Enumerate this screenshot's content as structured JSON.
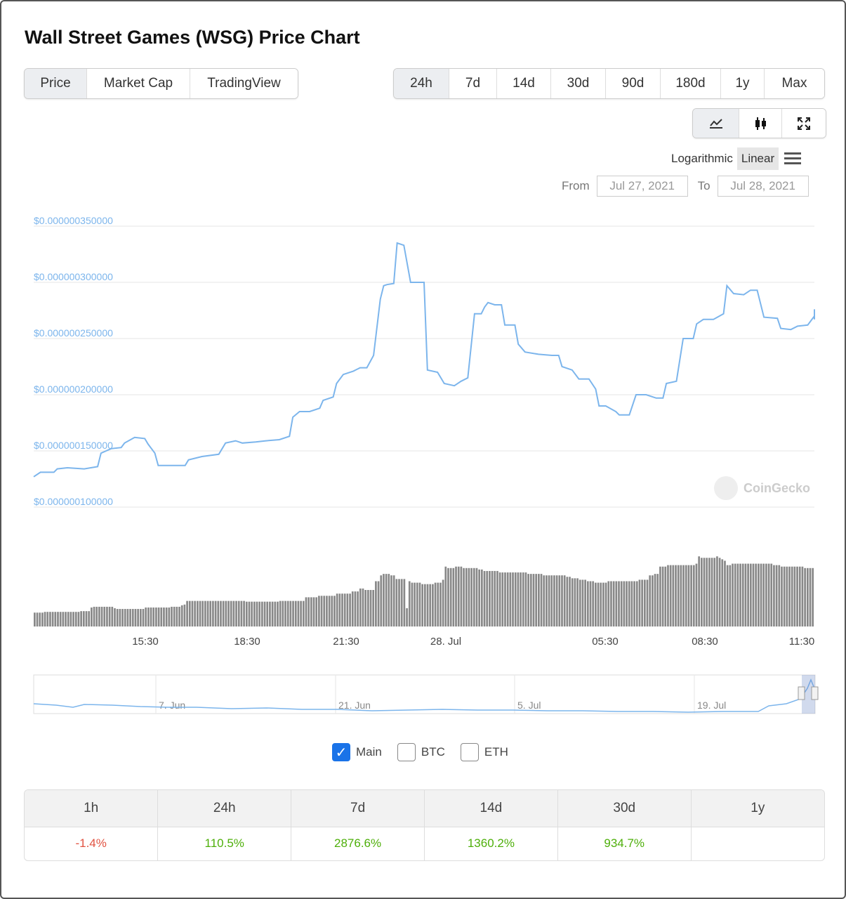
{
  "title": "Wall Street Games (WSG) Price Chart",
  "tabs": [
    "Price",
    "Market Cap",
    "TradingView"
  ],
  "ranges": [
    "24h",
    "7d",
    "14d",
    "30d",
    "90d",
    "180d",
    "1y",
    "Max"
  ],
  "chart_type_icons": [
    "line-chart-icon",
    "candlestick-icon",
    "fullscreen-icon"
  ],
  "scale": {
    "log": "Logarithmic",
    "linear": "Linear"
  },
  "date_range": {
    "from_label": "From",
    "from": "Jul 27, 2021",
    "to_label": "To",
    "to": "Jul 28, 2021"
  },
  "watermark": "CoinGecko",
  "colors": {
    "line": "#7cb5ec",
    "volume": "#888888",
    "positive": "#4eaf0a",
    "negative": "#e15241",
    "checkbox": "#1a73e8"
  },
  "series_toggles": [
    {
      "label": "Main",
      "checked": true
    },
    {
      "label": "BTC",
      "checked": false
    },
    {
      "label": "ETH",
      "checked": false
    }
  ],
  "stats": {
    "headers": [
      "1h",
      "24h",
      "7d",
      "14d",
      "30d",
      "1y"
    ],
    "values": [
      "-1.4%",
      "110.5%",
      "2876.6%",
      "1360.2%",
      "934.7%",
      ""
    ]
  },
  "chart_data": {
    "type": "line",
    "ylim": [
      1e-07,
      3.5e-07
    ],
    "y_tick_labels": [
      "$0.000000350000",
      "$0.000000300000",
      "$0.000000250000",
      "$0.000000200000",
      "$0.000000150000",
      "$0.000000100000"
    ],
    "y_ticks": [
      3.5e-07,
      3e-07,
      2.5e-07,
      2e-07,
      1.5e-07,
      1e-07
    ],
    "x_tick_labels": [
      "15:30",
      "18:30",
      "21:30",
      "28. Jul",
      "05:30",
      "08:30",
      "11:30"
    ],
    "x_range_hours": [
      12.3,
      35.5
    ],
    "x_ticks_hours": [
      15.5,
      18.5,
      21.5,
      24.5,
      29.5,
      32.5,
      35.5
    ],
    "price": [
      [
        12.3,
        1.27e-07
      ],
      [
        12.5,
        1.31e-07
      ],
      [
        12.9,
        1.31e-07
      ],
      [
        13.0,
        1.34e-07
      ],
      [
        13.3,
        1.35e-07
      ],
      [
        13.8,
        1.34e-07
      ],
      [
        14.0,
        1.35e-07
      ],
      [
        14.2,
        1.36e-07
      ],
      [
        14.3,
        1.48e-07
      ],
      [
        14.6,
        1.52e-07
      ],
      [
        14.9,
        1.53e-07
      ],
      [
        15.0,
        1.57e-07
      ],
      [
        15.3,
        1.62e-07
      ],
      [
        15.6,
        1.61e-07
      ],
      [
        15.7,
        1.56e-07
      ],
      [
        15.9,
        1.48e-07
      ],
      [
        16.0,
        1.37e-07
      ],
      [
        16.5,
        1.37e-07
      ],
      [
        16.8,
        1.37e-07
      ],
      [
        16.9,
        1.42e-07
      ],
      [
        17.3,
        1.45e-07
      ],
      [
        17.8,
        1.47e-07
      ],
      [
        17.9,
        1.52e-07
      ],
      [
        18.0,
        1.57e-07
      ],
      [
        18.3,
        1.59e-07
      ],
      [
        18.5,
        1.57e-07
      ],
      [
        18.9,
        1.58e-07
      ],
      [
        19.2,
        1.59e-07
      ],
      [
        19.6,
        1.6e-07
      ],
      [
        19.9,
        1.63e-07
      ],
      [
        20.0,
        1.8e-07
      ],
      [
        20.2,
        1.85e-07
      ],
      [
        20.5,
        1.85e-07
      ],
      [
        20.8,
        1.88e-07
      ],
      [
        20.9,
        1.95e-07
      ],
      [
        21.2,
        1.98e-07
      ],
      [
        21.3,
        2.1e-07
      ],
      [
        21.5,
        2.18e-07
      ],
      [
        21.8,
        2.21e-07
      ],
      [
        22.0,
        2.24e-07
      ],
      [
        22.2,
        2.24e-07
      ],
      [
        22.4,
        2.35e-07
      ],
      [
        22.6,
        2.85e-07
      ],
      [
        22.7,
        2.97e-07
      ],
      [
        22.8,
        2.98e-07
      ],
      [
        23.0,
        2.99e-07
      ],
      [
        23.1,
        3.35e-07
      ],
      [
        23.3,
        3.33e-07
      ],
      [
        23.5,
        3e-07
      ],
      [
        23.7,
        3e-07
      ],
      [
        23.9,
        3e-07
      ],
      [
        24.0,
        2.22e-07
      ],
      [
        24.3,
        2.2e-07
      ],
      [
        24.5,
        2.1e-07
      ],
      [
        24.8,
        2.08e-07
      ],
      [
        25.0,
        2.12e-07
      ],
      [
        25.2,
        2.15e-07
      ],
      [
        25.4,
        2.72e-07
      ],
      [
        25.6,
        2.72e-07
      ],
      [
        25.7,
        2.78e-07
      ],
      [
        25.8,
        2.82e-07
      ],
      [
        26.0,
        2.8e-07
      ],
      [
        26.2,
        2.8e-07
      ],
      [
        26.3,
        2.62e-07
      ],
      [
        26.6,
        2.62e-07
      ],
      [
        26.7,
        2.45e-07
      ],
      [
        26.9,
        2.38e-07
      ],
      [
        27.3,
        2.36e-07
      ],
      [
        27.7,
        2.35e-07
      ],
      [
        27.9,
        2.35e-07
      ],
      [
        28.0,
        2.25e-07
      ],
      [
        28.3,
        2.22e-07
      ],
      [
        28.5,
        2.14e-07
      ],
      [
        28.8,
        2.14e-07
      ],
      [
        29.0,
        2.05e-07
      ],
      [
        29.1,
        1.9e-07
      ],
      [
        29.3,
        1.9e-07
      ],
      [
        29.6,
        1.85e-07
      ],
      [
        29.7,
        1.82e-07
      ],
      [
        30.0,
        1.82e-07
      ],
      [
        30.2,
        2e-07
      ],
      [
        30.5,
        2e-07
      ],
      [
        30.8,
        1.97e-07
      ],
      [
        31.0,
        1.97e-07
      ],
      [
        31.1,
        2.1e-07
      ],
      [
        31.4,
        2.12e-07
      ],
      [
        31.6,
        2.5e-07
      ],
      [
        31.9,
        2.5e-07
      ],
      [
        32.0,
        2.63e-07
      ],
      [
        32.2,
        2.67e-07
      ],
      [
        32.5,
        2.67e-07
      ],
      [
        32.8,
        2.72e-07
      ],
      [
        32.9,
        2.97e-07
      ],
      [
        33.1,
        2.9e-07
      ],
      [
        33.4,
        2.89e-07
      ],
      [
        33.6,
        2.93e-07
      ],
      [
        33.8,
        2.93e-07
      ],
      [
        34.0,
        2.69e-07
      ],
      [
        34.4,
        2.68e-07
      ],
      [
        34.5,
        2.59e-07
      ],
      [
        34.8,
        2.58e-07
      ],
      [
        35.0,
        2.61e-07
      ],
      [
        35.3,
        2.62e-07
      ],
      [
        35.5,
        2.7e-07
      ],
      [
        35.8,
        2.75e-07
      ],
      [
        36.0,
        2.76e-07
      ],
      [
        36.1,
        2.73e-07
      ],
      [
        36.3,
        2.68e-07
      ],
      [
        36.5,
        2.67e-07
      ]
    ],
    "volume_relative": [
      0.19,
      0.19,
      0.19,
      0.19,
      0.2,
      0.2,
      0.2,
      0.2,
      0.2,
      0.2,
      0.2,
      0.2,
      0.2,
      0.2,
      0.2,
      0.2,
      0.2,
      0.2,
      0.21,
      0.21,
      0.21,
      0.21,
      0.26,
      0.27,
      0.27,
      0.27,
      0.27,
      0.27,
      0.27,
      0.27,
      0.27,
      0.25,
      0.24,
      0.24,
      0.24,
      0.24,
      0.24,
      0.24,
      0.24,
      0.24,
      0.24,
      0.24,
      0.24,
      0.26,
      0.26,
      0.26,
      0.26,
      0.26,
      0.26,
      0.26,
      0.26,
      0.26,
      0.26,
      0.27,
      0.27,
      0.27,
      0.27,
      0.29,
      0.3,
      0.35,
      0.35,
      0.35,
      0.35,
      0.35,
      0.35,
      0.35,
      0.35,
      0.35,
      0.35,
      0.35,
      0.35,
      0.35,
      0.35,
      0.35,
      0.35,
      0.35,
      0.35,
      0.35,
      0.35,
      0.35,
      0.35,
      0.35,
      0.34,
      0.34,
      0.34,
      0.34,
      0.34,
      0.34,
      0.34,
      0.34,
      0.34,
      0.34,
      0.34,
      0.34,
      0.34,
      0.35,
      0.35,
      0.35,
      0.35,
      0.35,
      0.35,
      0.35,
      0.35,
      0.35,
      0.35,
      0.4,
      0.4,
      0.4,
      0.4,
      0.4,
      0.42,
      0.42,
      0.42,
      0.42,
      0.42,
      0.42,
      0.42,
      0.45,
      0.45,
      0.45,
      0.45,
      0.45,
      0.45,
      0.48,
      0.48,
      0.48,
      0.52,
      0.52,
      0.5,
      0.5,
      0.5,
      0.5,
      0.62,
      0.62,
      0.7,
      0.72,
      0.72,
      0.72,
      0.7,
      0.7,
      0.65,
      0.65,
      0.65,
      0.65,
      0.25,
      0.62,
      0.6,
      0.6,
      0.6,
      0.6,
      0.58,
      0.58,
      0.58,
      0.58,
      0.58,
      0.6,
      0.6,
      0.6,
      0.64,
      0.82,
      0.8,
      0.8,
      0.8,
      0.82,
      0.82,
      0.82,
      0.8,
      0.8,
      0.8,
      0.8,
      0.8,
      0.8,
      0.78,
      0.78,
      0.76,
      0.76,
      0.76,
      0.76,
      0.76,
      0.76,
      0.74,
      0.74,
      0.74,
      0.74,
      0.74,
      0.74,
      0.74,
      0.74,
      0.74,
      0.74,
      0.74,
      0.72,
      0.72,
      0.72,
      0.72,
      0.72,
      0.72,
      0.7,
      0.7,
      0.7,
      0.7,
      0.7,
      0.7,
      0.7,
      0.7,
      0.7,
      0.68,
      0.68,
      0.66,
      0.66,
      0.66,
      0.64,
      0.64,
      0.64,
      0.62,
      0.62,
      0.62,
      0.6,
      0.6,
      0.6,
      0.6,
      0.6,
      0.62,
      0.62,
      0.62,
      0.62,
      0.62,
      0.62,
      0.62,
      0.62,
      0.62,
      0.62,
      0.62,
      0.62,
      0.64,
      0.64,
      0.64,
      0.64,
      0.7,
      0.7,
      0.72,
      0.72,
      0.82,
      0.82,
      0.82,
      0.84,
      0.84,
      0.84,
      0.84,
      0.84,
      0.84,
      0.84,
      0.84,
      0.84,
      0.84,
      0.84,
      0.86,
      0.96,
      0.94,
      0.94,
      0.94,
      0.94,
      0.94,
      0.94,
      0.96,
      0.94,
      0.92,
      0.9,
      0.84,
      0.84,
      0.86,
      0.86,
      0.86,
      0.86,
      0.86,
      0.86,
      0.86,
      0.86,
      0.86,
      0.86,
      0.86,
      0.86,
      0.86,
      0.86,
      0.86,
      0.86,
      0.84,
      0.84,
      0.84,
      0.82,
      0.82,
      0.82,
      0.82,
      0.82,
      0.82,
      0.82,
      0.82,
      0.82,
      0.8,
      0.8,
      0.8,
      0.8
    ],
    "navigator": {
      "x_tick_labels": [
        "7. Jun",
        "21. Jun",
        "5. Jul",
        "19. Jul"
      ]
    }
  }
}
